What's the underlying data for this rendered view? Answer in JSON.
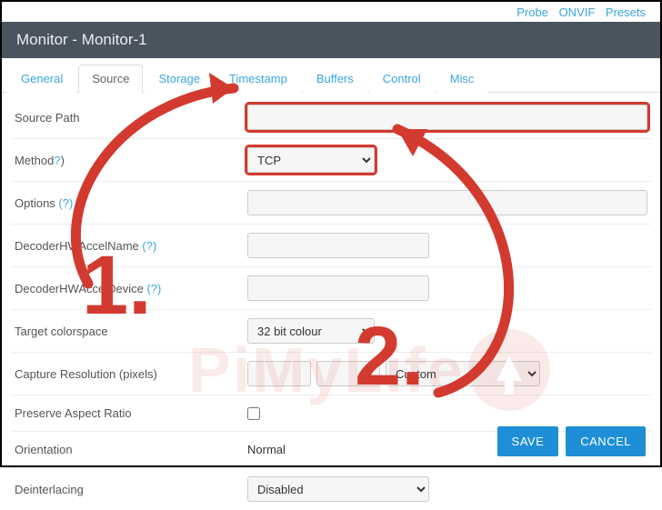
{
  "top_links": {
    "probe": "Probe",
    "onvif": "ONVIF",
    "presets": "Presets"
  },
  "header": {
    "title": "Monitor - Monitor-1"
  },
  "tabs": [
    {
      "id": "general",
      "label": "General"
    },
    {
      "id": "source",
      "label": "Source"
    },
    {
      "id": "storage",
      "label": "Storage"
    },
    {
      "id": "timestamp",
      "label": "Timestamp"
    },
    {
      "id": "buffers",
      "label": "Buffers"
    },
    {
      "id": "control",
      "label": "Control"
    },
    {
      "id": "misc",
      "label": "Misc"
    }
  ],
  "active_tab": "source",
  "form": {
    "source_path": {
      "label": "Source Path",
      "value": ""
    },
    "method": {
      "label": "Method",
      "help": "?",
      "value": "TCP",
      "options": [
        "TCP"
      ]
    },
    "options": {
      "label": "Options ",
      "help": "(?)",
      "value": ""
    },
    "decoder_name": {
      "label": "DecoderHWAccelName ",
      "help": "(?)",
      "value": ""
    },
    "decoder_dev": {
      "label": "DecoderHWAccelDevice ",
      "help": "(?)",
      "value": ""
    },
    "colorspace": {
      "label": "Target colorspace",
      "value": "32 bit colour",
      "options": [
        "32 bit colour"
      ]
    },
    "capture_res": {
      "label": "Capture Resolution (pixels)",
      "width": "",
      "height": "",
      "preset": "Custom",
      "options": [
        "Custom"
      ]
    },
    "preserve_ar": {
      "label": "Preserve Aspect Ratio",
      "checked": false
    },
    "orientation": {
      "label": "Orientation",
      "value": "Normal"
    },
    "deinterlacing": {
      "label": "Deinterlacing",
      "value": "Disabled",
      "options": [
        "Disabled"
      ]
    }
  },
  "buttons": {
    "save": "SAVE",
    "cancel": "CANCEL"
  },
  "annotations": {
    "num1": "1.",
    "num2": "2.",
    "highlight_source_path": true,
    "highlight_method": true
  },
  "watermark": {
    "text": "PiMyLife",
    "brand": "Up"
  }
}
